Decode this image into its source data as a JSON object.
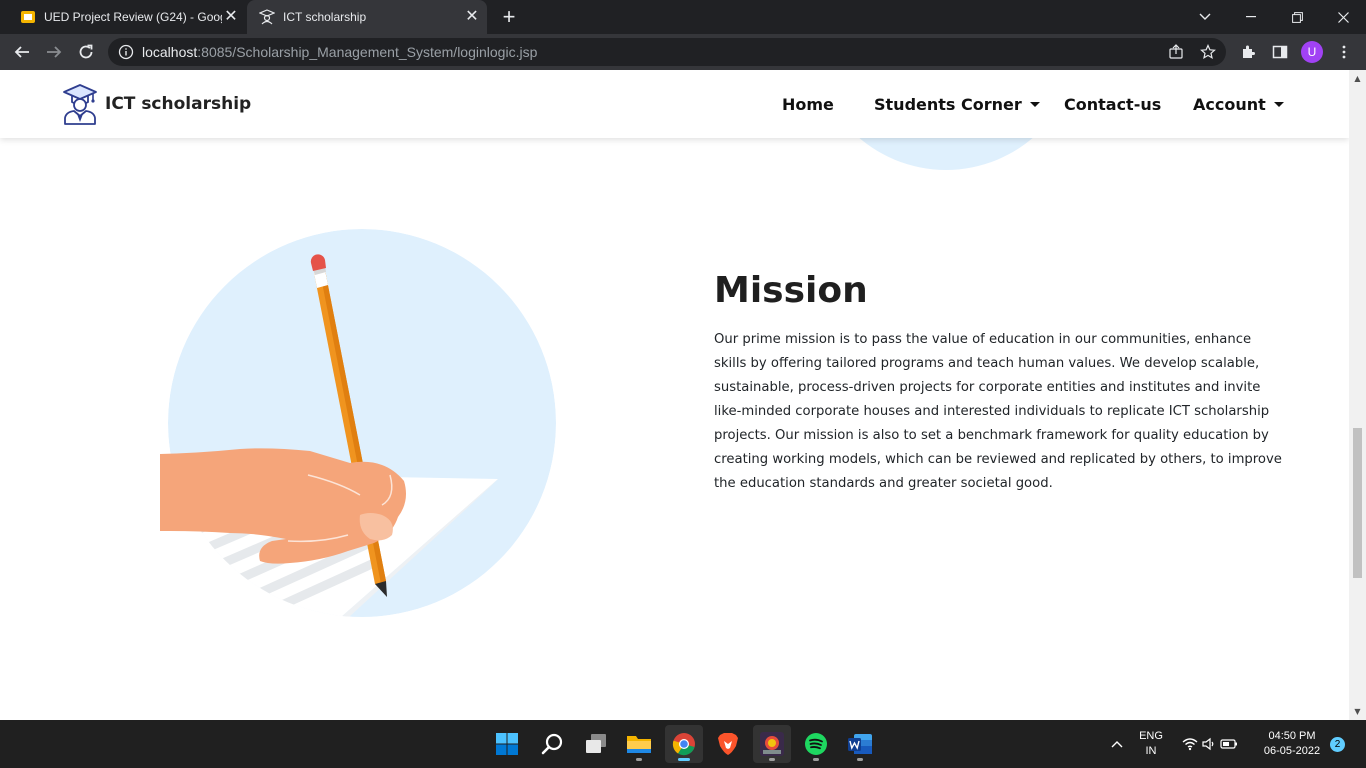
{
  "browser": {
    "tabs": [
      {
        "title": "UED Project Review (G24) - Goog",
        "favicon": "slides-icon"
      },
      {
        "title": "ICT scholarship",
        "favicon": "graduate-icon"
      }
    ],
    "address": {
      "host": "localhost",
      "rest": ":8085/Scholarship_Management_System/loginlogic.jsp"
    },
    "profile_initial": "U"
  },
  "site": {
    "brand": "ICT scholarship",
    "nav": {
      "home": "Home",
      "students_corner": "Students Corner",
      "contact": "Contact-us",
      "account": "Account"
    },
    "mission": {
      "title": "Mission",
      "text": "Our prime mission is to pass the value of education in our communities, enhance skills by offering tailored programs and teach human values. We develop scalable, sustainable, process-driven projects for corporate entities and institutes and invite like-minded corporate houses and interested individuals to replicate ICT scholarship projects. Our mission is also to set a benchmark framework for quality education by creating working models, which can be reviewed and replicated by others, to improve the education standards and greater societal good."
    }
  },
  "taskbar": {
    "lang": "ENG",
    "region": "IN",
    "time": "04:50 PM",
    "date": "06-05-2022",
    "notifications": "2"
  },
  "colors": {
    "accent_circle": "#dff0fd",
    "pencil": "#f0941f",
    "hand": "#f5a57a"
  }
}
